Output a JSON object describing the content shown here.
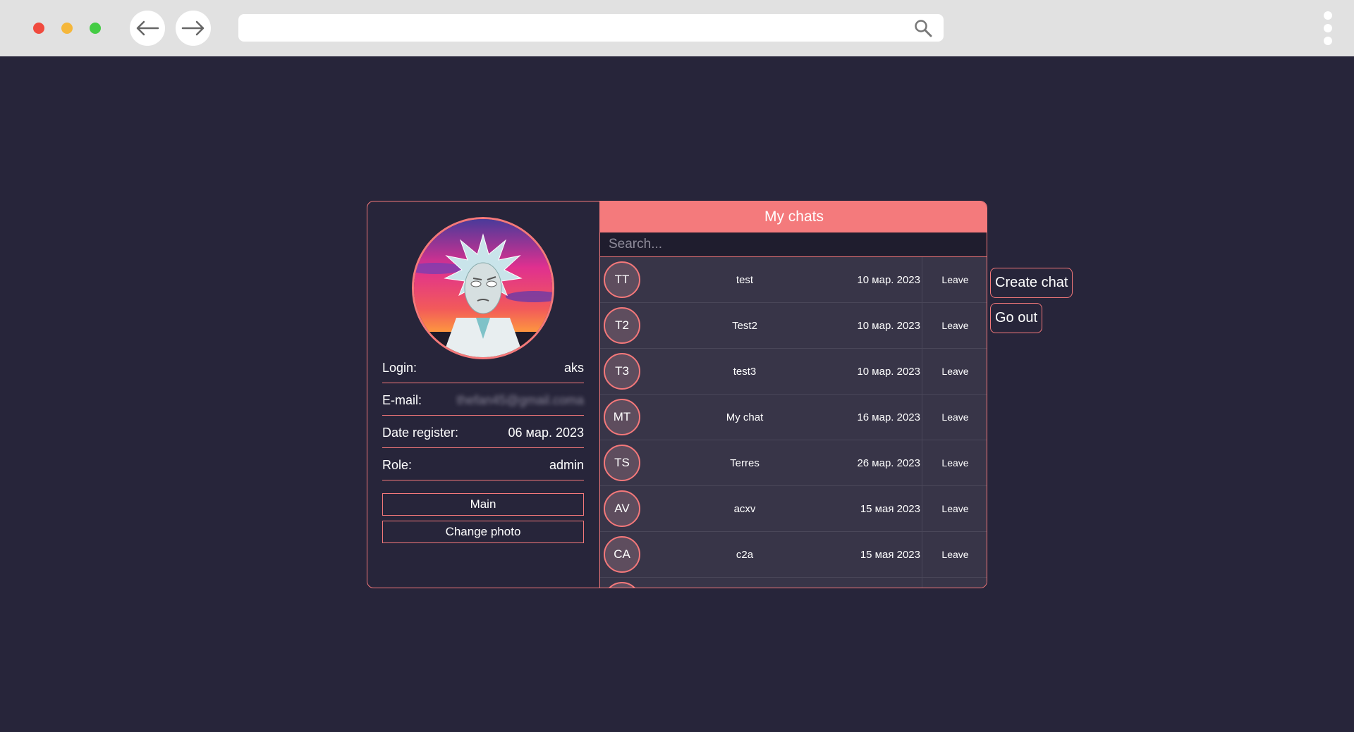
{
  "browser": {
    "icons": {
      "back": "arrow-left-icon",
      "forward": "arrow-right-icon",
      "search": "search-icon",
      "menu": "more-vertical-icon"
    },
    "window_controls": {
      "close_color": "#f04a3e",
      "minimize_color": "#f5b73b",
      "maximize_color": "#44cc44"
    }
  },
  "colors": {
    "accent": "#f47a7c",
    "background": "#27253a",
    "row": "#383548"
  },
  "profile": {
    "login_label": "Login:",
    "login_value": "aks",
    "email_label": "E-mail:",
    "email_value": "thefan45@gmail.coma",
    "date_label": "Date register:",
    "date_value": "06 мар. 2023",
    "role_label": "Role:",
    "role_value": "admin",
    "main_button": "Main",
    "change_photo_button": "Change photo"
  },
  "chats": {
    "header": "My chats",
    "search_placeholder": "Search...",
    "items": [
      {
        "initials": "TT",
        "name": "test",
        "date": "10 мар. 2023",
        "action": "Leave"
      },
      {
        "initials": "T2",
        "name": "Test2",
        "date": "10 мар. 2023",
        "action": "Leave"
      },
      {
        "initials": "T3",
        "name": "test3",
        "date": "10 мар. 2023",
        "action": "Leave"
      },
      {
        "initials": "MT",
        "name": "My chat",
        "date": "16 мар. 2023",
        "action": "Leave"
      },
      {
        "initials": "TS",
        "name": "Terres",
        "date": "26 мар. 2023",
        "action": "Leave"
      },
      {
        "initials": "AV",
        "name": "acxv",
        "date": "15 мая 2023",
        "action": "Leave"
      },
      {
        "initials": "CA",
        "name": "c2a",
        "date": "15 мая 2023",
        "action": "Leave"
      }
    ]
  },
  "actions": {
    "create_chat": "Create chat",
    "go_out": "Go out"
  }
}
